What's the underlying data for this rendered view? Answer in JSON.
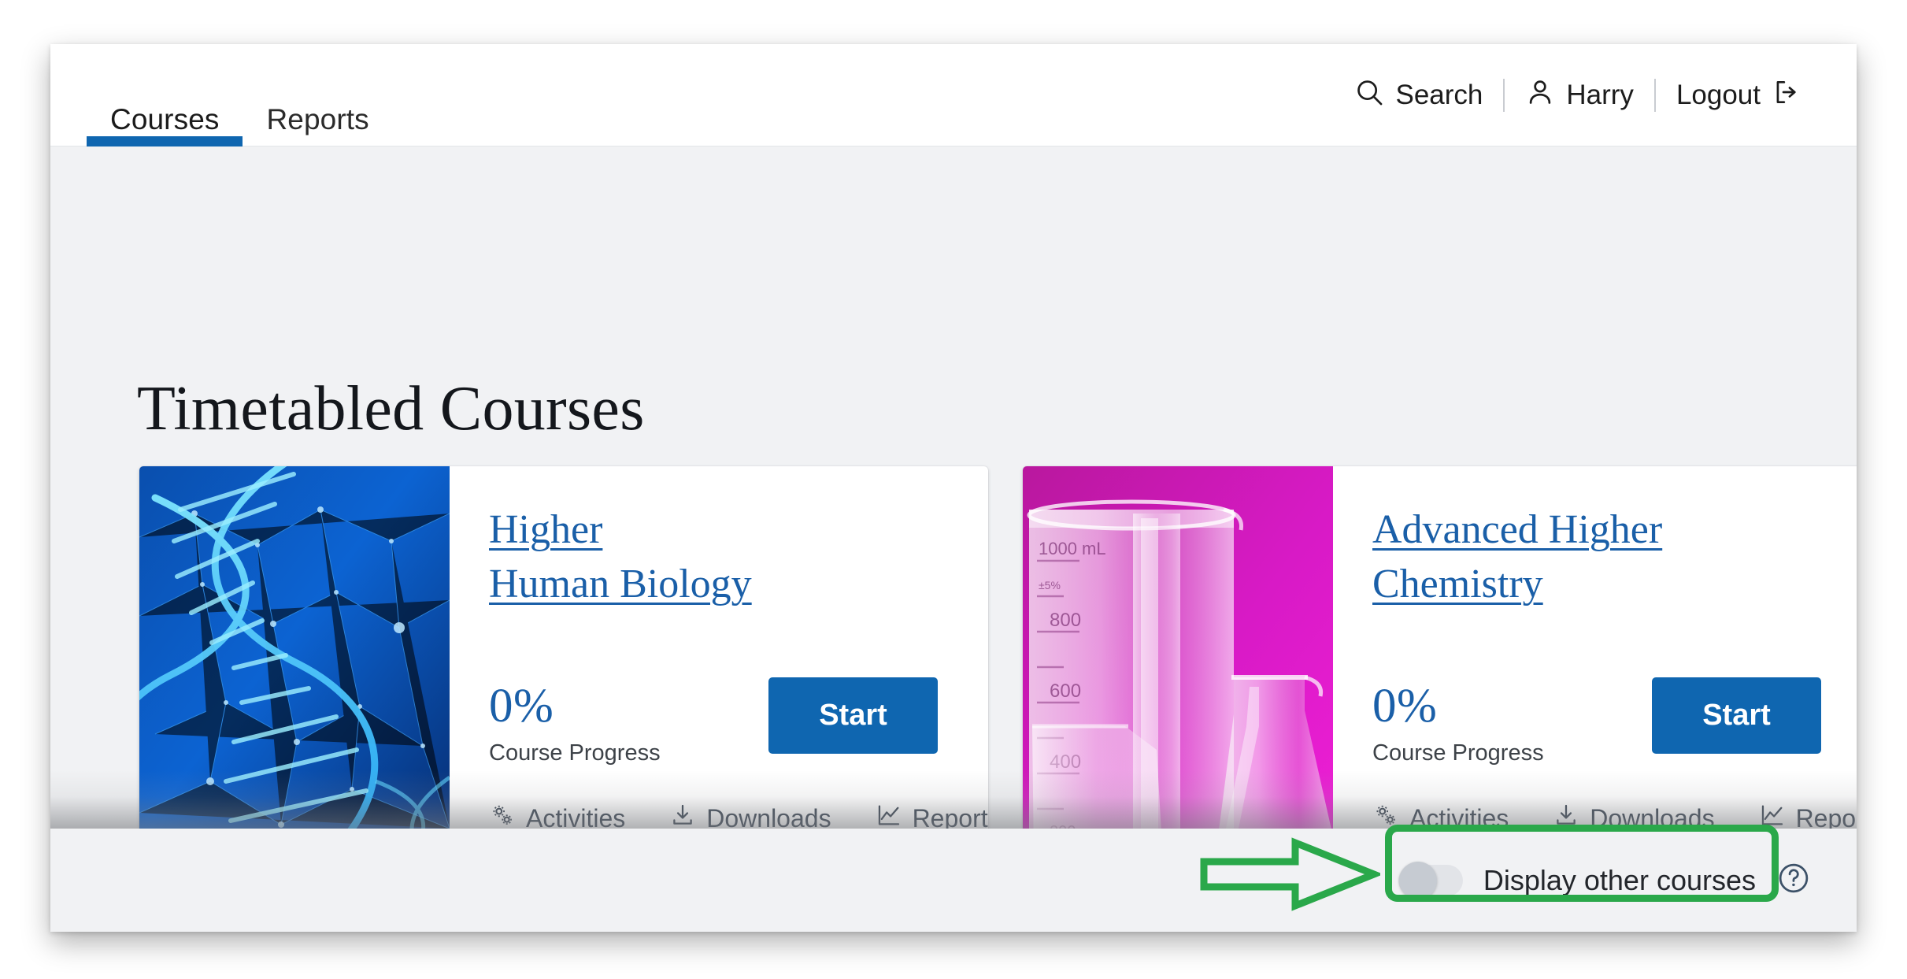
{
  "header": {
    "tabs": [
      {
        "label": "Courses",
        "active": true
      },
      {
        "label": "Reports",
        "active": false
      }
    ],
    "search_label": "Search",
    "search_icon": "search-icon",
    "user_label": "Harry",
    "user_icon": "user-icon",
    "logout_label": "Logout",
    "logout_icon": "logout-icon",
    "accent_color": "#0f66b0"
  },
  "main": {
    "page_title": "Timetabled Courses",
    "background_color": "#f1f2f4"
  },
  "courses": [
    {
      "title_line1": "Higher",
      "title_line2": "Human Biology",
      "thumb": "dna-helix-image",
      "thumb_color": "#0b63c9",
      "progress_value": "0%",
      "progress_label": "Course Progress",
      "start_label": "Start",
      "actions": [
        {
          "label": "Activities",
          "icon": "gears-icon"
        },
        {
          "label": "Downloads",
          "icon": "download-icon"
        },
        {
          "label": "Reports",
          "icon": "line-chart-icon"
        }
      ]
    },
    {
      "title_line1": "Advanced Higher",
      "title_line2": "Chemistry",
      "thumb": "beakers-image",
      "thumb_color": "#d81ac6",
      "progress_value": "0%",
      "progress_label": "Course Progress",
      "start_label": "Start",
      "actions": [
        {
          "label": "Activities",
          "icon": "gears-icon"
        },
        {
          "label": "Downloads",
          "icon": "download-icon"
        },
        {
          "label": "Reports",
          "icon": "line-chart-icon"
        }
      ]
    }
  ],
  "footer": {
    "toggle_label": "Display other courses",
    "toggle_state": "off",
    "help_icon": "help-circle-icon"
  },
  "annotation": {
    "highlight_color": "#2aa84a",
    "arrow_icon": "right-arrow-annotation",
    "box_icon": "highlight-box-annotation"
  }
}
